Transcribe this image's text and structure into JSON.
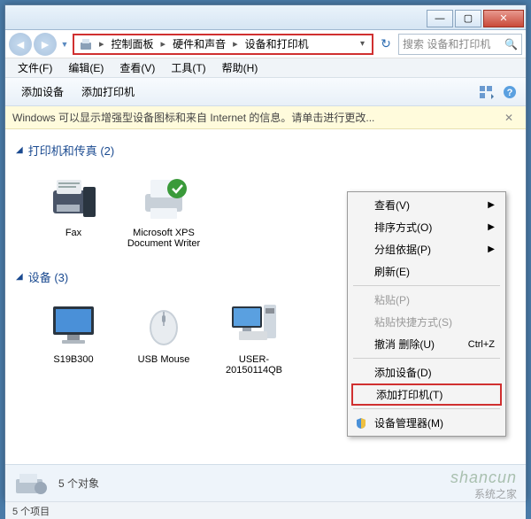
{
  "window": {
    "minimize": "—",
    "maximize": "▢",
    "close": "✕"
  },
  "breadcrumb": {
    "items": [
      "控制面板",
      "硬件和声音",
      "设备和打印机"
    ]
  },
  "search": {
    "placeholder": "搜索 设备和打印机",
    "icon": "🔍"
  },
  "menubar": {
    "file": "文件(F)",
    "edit": "编辑(E)",
    "view": "查看(V)",
    "tools": "工具(T)",
    "help": "帮助(H)"
  },
  "toolbar": {
    "add_device": "添加设备",
    "add_printer": "添加打印机"
  },
  "infobar": {
    "text": "Windows 可以显示增强型设备图标和来自 Internet 的信息。请单击进行更改..."
  },
  "sections": {
    "printers": {
      "title": "打印机和传真 (2)",
      "items": [
        {
          "name": "Fax"
        },
        {
          "name": "Microsoft XPS Document Writer"
        }
      ]
    },
    "devices": {
      "title": "设备 (3)",
      "items": [
        {
          "name": "S19B300"
        },
        {
          "name": "USB Mouse"
        },
        {
          "name": "USER-20150114QB"
        }
      ]
    }
  },
  "context_menu": {
    "view": "查看(V)",
    "sort": "排序方式(O)",
    "group": "分组依据(P)",
    "refresh": "刷新(E)",
    "paste": "粘贴(P)",
    "paste_shortcut": "粘贴快捷方式(S)",
    "undo_delete": "撤消 删除(U)",
    "undo_shortcut": "Ctrl+Z",
    "add_device": "添加设备(D)",
    "add_printer": "添加打印机(T)",
    "device_manager": "设备管理器(M)"
  },
  "status": {
    "object_count": "5 个对象"
  },
  "statusbar": {
    "items": "5 个项目"
  },
  "watermark": {
    "main": "shancun",
    "sub": "系统之家"
  }
}
